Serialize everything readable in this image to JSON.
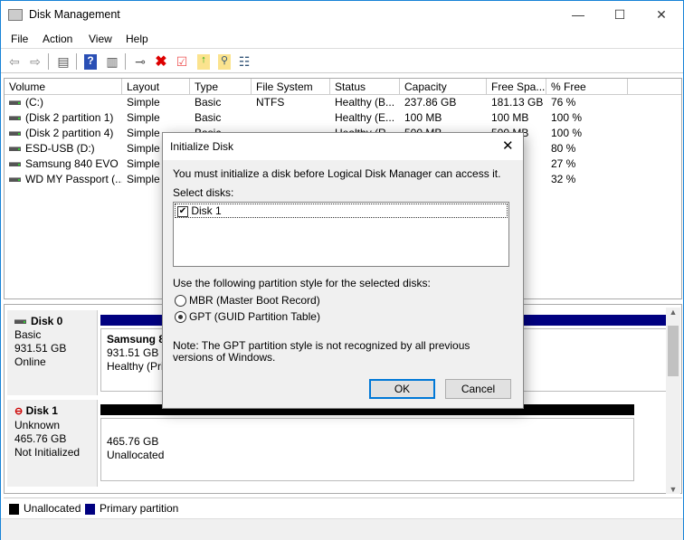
{
  "window": {
    "title": "Disk Management",
    "controls": {
      "minimize": "—",
      "maximize": "☐",
      "close": "✕"
    }
  },
  "menu": [
    "File",
    "Action",
    "View",
    "Help"
  ],
  "toolbar": [
    "back-icon",
    "forward-icon",
    "console-tree-icon",
    "help-icon",
    "action-pane-icon",
    "connect-drive-icon",
    "delete-icon",
    "check-icon",
    "folder-up-icon",
    "folder-search-icon",
    "properties-icon"
  ],
  "volumes": {
    "columns": [
      "Volume",
      "Layout",
      "Type",
      "File System",
      "Status",
      "Capacity",
      "Free Spa...",
      "% Free"
    ],
    "rows": [
      [
        "(C:)",
        "Simple",
        "Basic",
        "NTFS",
        "Healthy (B...",
        "237.86 GB",
        "181.13 GB",
        "76 %"
      ],
      [
        "(Disk 2 partition 1)",
        "Simple",
        "Basic",
        "",
        "Healthy (E...",
        "100 MB",
        "100 MB",
        "100 %"
      ],
      [
        "(Disk 2 partition 4)",
        "Simple",
        "Basic",
        "",
        "Healthy (R...",
        "500 MB",
        "500 MB",
        "100 %"
      ],
      [
        "ESD-USB (D:)",
        "Simple",
        "",
        "",
        "",
        "",
        "GB",
        "80 %"
      ],
      [
        "Samsung 840 EVO ...",
        "Simple",
        "",
        "",
        "",
        "",
        "GB",
        "27 %"
      ],
      [
        "WD MY Passport (...",
        "Simple",
        "",
        "",
        "",
        "",
        "GB",
        "32 %"
      ]
    ]
  },
  "disks": [
    {
      "name": "Disk 0",
      "type": "Basic",
      "size": "931.51 GB",
      "state": "Online",
      "partition": {
        "name": "Samsung 84",
        "size": "931.51 GB N",
        "status": "Healthy (Pri"
      },
      "bar_color": "#000080"
    },
    {
      "name": "Disk 1",
      "type": "Unknown",
      "size": "465.76 GB",
      "state": "Not Initialized",
      "partition": {
        "size": "465.76 GB",
        "status": "Unallocated"
      },
      "bar_color": "#000000"
    }
  ],
  "legend": [
    {
      "label": "Unallocated",
      "color": "#000000"
    },
    {
      "label": "Primary partition",
      "color": "#000080"
    }
  ],
  "dialog": {
    "title": "Initialize Disk",
    "message": "You must initialize a disk before Logical Disk Manager can access it.",
    "select_label": "Select disks:",
    "disks": [
      {
        "label": "Disk 1",
        "checked": true
      }
    ],
    "style_label": "Use the following partition style for the selected disks:",
    "options": [
      {
        "label": "MBR (Master Boot Record)",
        "selected": false
      },
      {
        "label": "GPT (GUID Partition Table)",
        "selected": true
      }
    ],
    "note": "Note: The GPT partition style is not recognized by all previous versions of Windows.",
    "ok": "OK",
    "cancel": "Cancel",
    "close": "✕"
  }
}
